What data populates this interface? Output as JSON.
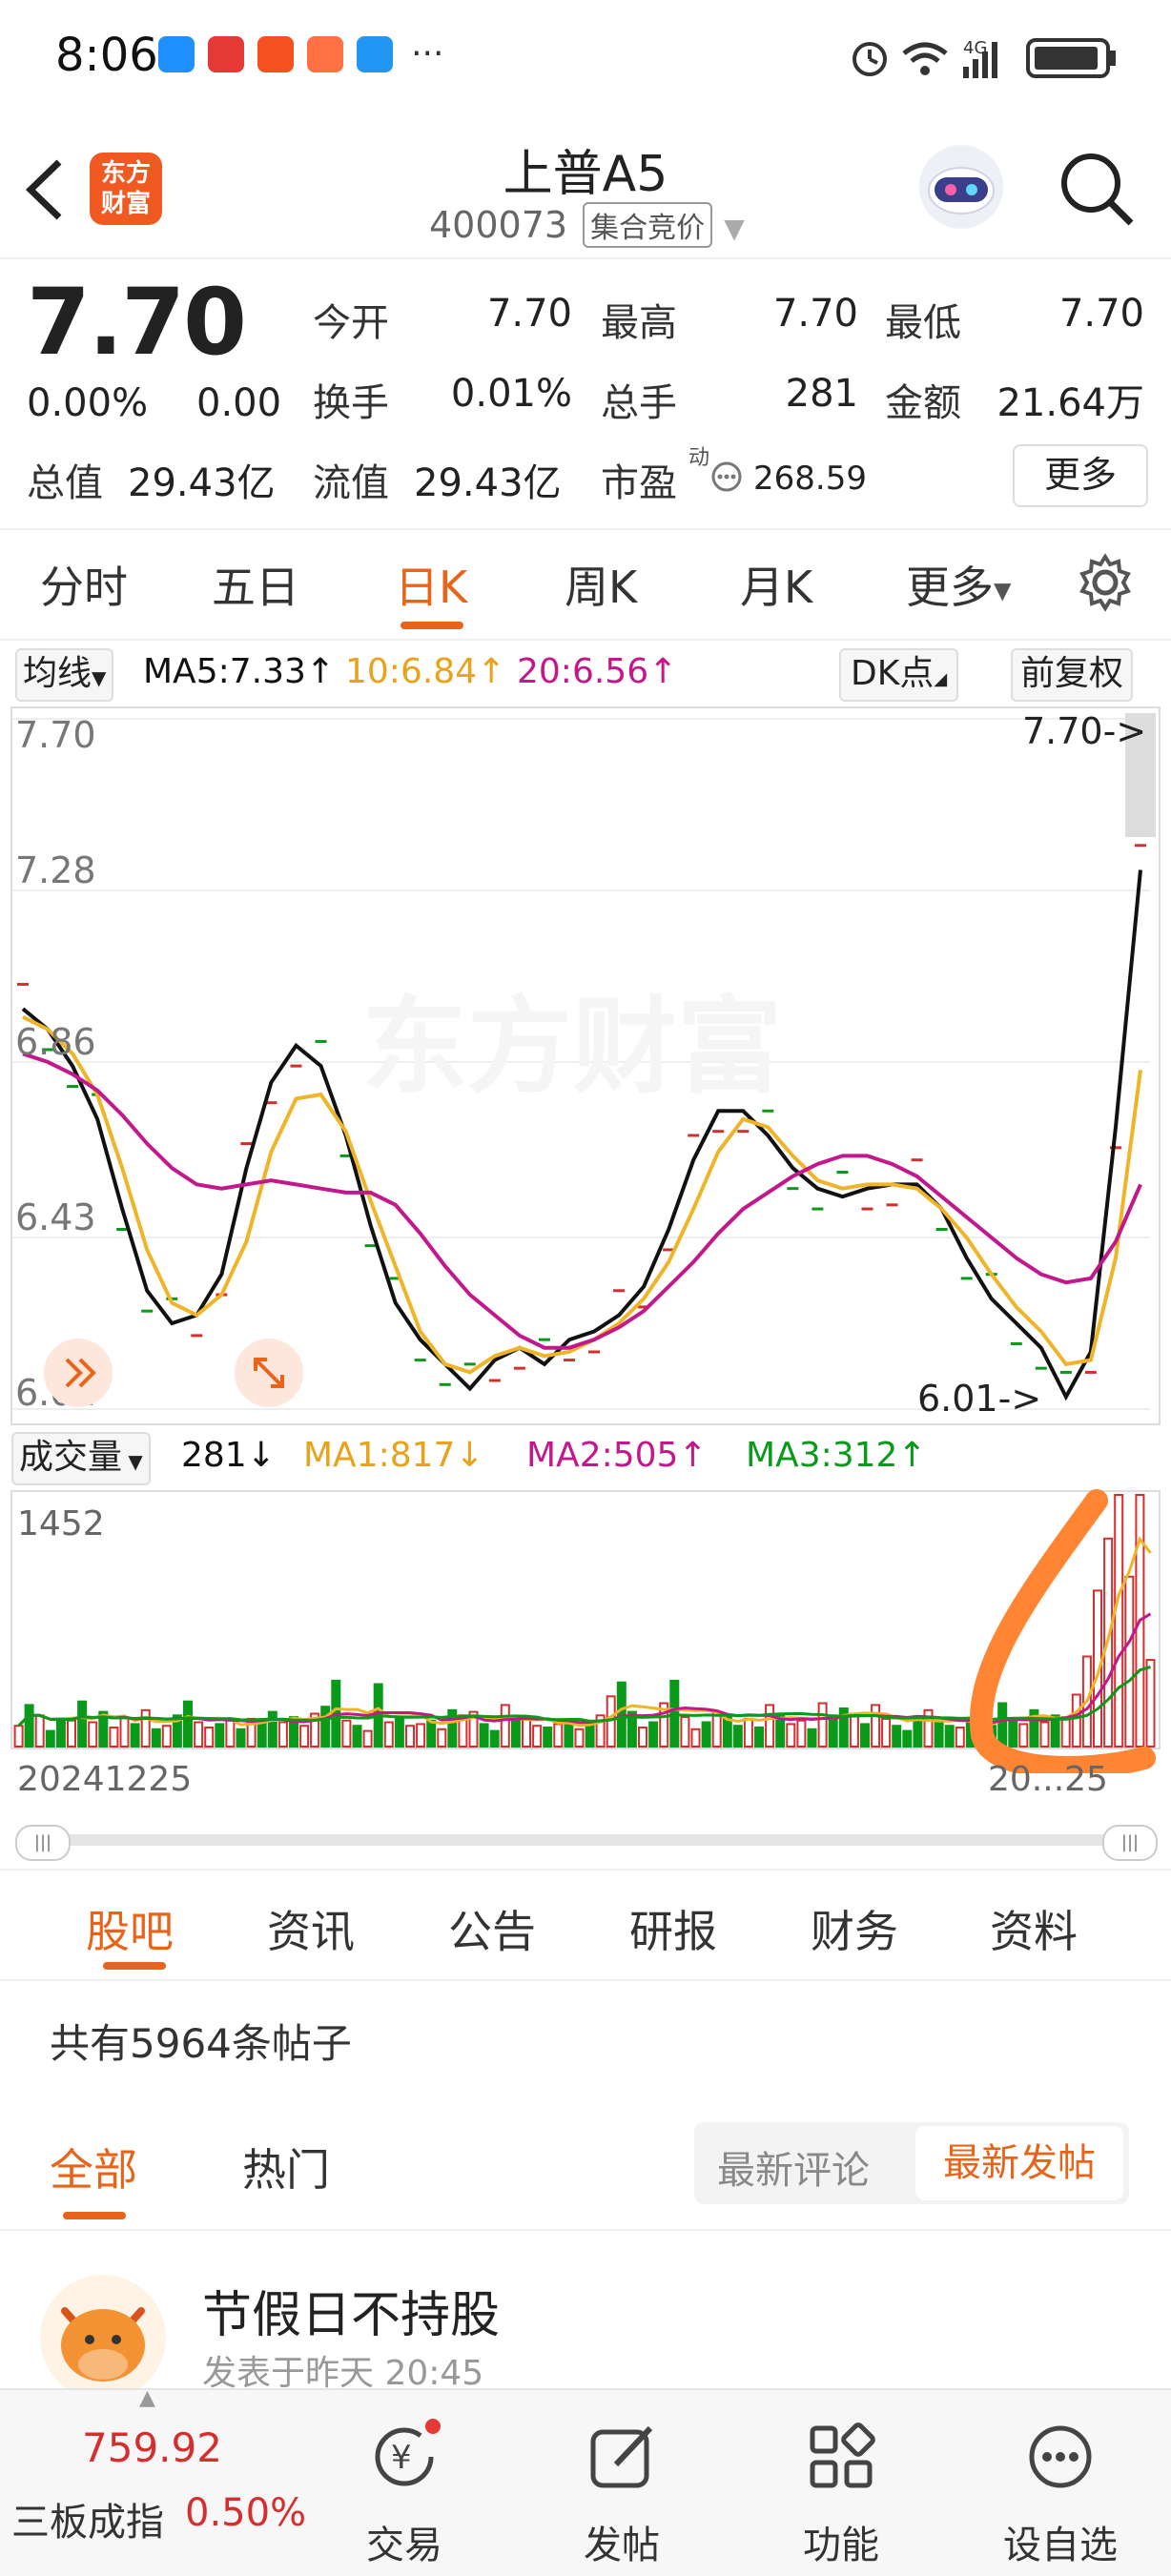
{
  "status_bar": {
    "time": "8:06",
    "more": "···",
    "network": "4G",
    "apps": [
      {
        "name": "哈啰",
        "color": "#1e90ff"
      },
      {
        "name": "日历",
        "color": "#e53935"
      },
      {
        "name": "平安银行",
        "color": "#f4511e"
      },
      {
        "name": "app",
        "color": "#ff7043"
      },
      {
        "name": "天气",
        "color": "#2196f3"
      }
    ]
  },
  "header": {
    "back_icon": "chevron-left-icon",
    "logo_text_1": "东方",
    "logo_text_2": "财富",
    "stock_name": "上普A5",
    "stock_code": "400073",
    "trade_mode": "集合竞价",
    "search_icon": "search-icon"
  },
  "quote": {
    "price": "7.70",
    "change_pct": "0.00%",
    "change": "0.00",
    "open_label": "今开",
    "open": "7.70",
    "high_label": "最高",
    "high": "7.70",
    "low_label": "最低",
    "low": "7.70",
    "turnover_label": "换手",
    "turnover": "0.01%",
    "volume_label": "总手",
    "volume": "281",
    "amount_label": "金额",
    "amount": "21.64万",
    "mkt_cap_label": "总值",
    "mkt_cap": "29.43亿",
    "float_cap_label": "流值",
    "float_cap": "29.43亿",
    "pe_label": "市盈",
    "pe_sup": "动",
    "pe": "268.59",
    "more_button": "更多"
  },
  "chart_tabs": {
    "items": [
      "分时",
      "五日",
      "日K",
      "周K",
      "月K",
      "更多"
    ],
    "active": "日K"
  },
  "kline": {
    "indicator_select": "均线",
    "ma5": "MA5:7.33↑",
    "ma10": "10:6.84↑",
    "ma20": "20:6.56↑",
    "dk_button": "DK点",
    "adjust_button": "前复权",
    "max_marker": "7.70->",
    "min_marker": "6.01->",
    "watermark": "东方财富",
    "colors": {
      "ma5": "#111111",
      "ma10": "#f0b429",
      "ma20": "#c2188b",
      "up": "#d32f2f",
      "down": "#0a9a1a",
      "accent": "#e8641b"
    }
  },
  "volume": {
    "indicator_select": "成交量",
    "vol": "281↓",
    "ma1": "MA1:817↓",
    "ma2": "MA2:505↑",
    "ma3": "MA3:312↑",
    "start_date": "20241225",
    "end_date": "20...25"
  },
  "chart_data": [
    {
      "type": "line",
      "title": "",
      "y_ticks": [
        "7.70",
        "7.28",
        "6.86",
        "6.43",
        "6.01"
      ],
      "ylim": [
        6.01,
        7.7
      ],
      "series": [
        {
          "name": "MA5",
          "values": [
            6.99,
            6.94,
            6.85,
            6.72,
            6.5,
            6.3,
            6.22,
            6.24,
            6.34,
            6.6,
            6.81,
            6.9,
            6.85,
            6.68,
            6.46,
            6.27,
            6.18,
            6.12,
            6.06,
            6.13,
            6.16,
            6.12,
            6.18,
            6.2,
            6.24,
            6.31,
            6.45,
            6.62,
            6.74,
            6.74,
            6.68,
            6.6,
            6.55,
            6.53,
            6.55,
            6.56,
            6.56,
            6.5,
            6.38,
            6.28,
            6.22,
            6.16,
            6.04,
            6.15,
            6.7,
            7.33
          ]
        },
        {
          "name": "10",
          "values": [
            6.97,
            6.94,
            6.88,
            6.78,
            6.6,
            6.4,
            6.27,
            6.24,
            6.29,
            6.42,
            6.64,
            6.77,
            6.78,
            6.69,
            6.52,
            6.36,
            6.2,
            6.12,
            6.1,
            6.14,
            6.16,
            6.14,
            6.15,
            6.18,
            6.22,
            6.28,
            6.37,
            6.5,
            6.64,
            6.72,
            6.7,
            6.63,
            6.57,
            6.55,
            6.56,
            6.56,
            6.55,
            6.5,
            6.43,
            6.34,
            6.26,
            6.2,
            6.12,
            6.13,
            6.38,
            6.84
          ]
        },
        {
          "name": "20",
          "values": [
            6.88,
            6.86,
            6.83,
            6.79,
            6.73,
            6.66,
            6.6,
            6.56,
            6.55,
            6.56,
            6.57,
            6.56,
            6.55,
            6.54,
            6.54,
            6.51,
            6.44,
            6.36,
            6.29,
            6.24,
            6.19,
            6.16,
            6.16,
            6.18,
            6.21,
            6.25,
            6.31,
            6.37,
            6.44,
            6.5,
            6.54,
            6.58,
            6.61,
            6.63,
            6.63,
            6.61,
            6.58,
            6.53,
            6.48,
            6.43,
            6.38,
            6.34,
            6.32,
            6.33,
            6.42,
            6.56
          ]
        }
      ]
    },
    {
      "type": "bar",
      "title": "成交量",
      "y_ticks": [
        "1452"
      ],
      "ylim": [
        0,
        1452
      ],
      "values": [
        120,
        240,
        180,
        90,
        160,
        150,
        260,
        140,
        200,
        110,
        170,
        130,
        210,
        100,
        120,
        180,
        260,
        140,
        110,
        130,
        150,
        100,
        160,
        150,
        200,
        140,
        170,
        120,
        190,
        230,
        380,
        150,
        120,
        90,
        360,
        140,
        170,
        120,
        130,
        150,
        100,
        210,
        180,
        200,
        130,
        90,
        240,
        150,
        170,
        120,
        110,
        130,
        150,
        100,
        140,
        180,
        290,
        370,
        200,
        110,
        140,
        250,
        380,
        170,
        100,
        140,
        200,
        170,
        120,
        160,
        110,
        240,
        190,
        130,
        150,
        100,
        250,
        180,
        220,
        190,
        130,
        240,
        160,
        120,
        90,
        170,
        210,
        150,
        120,
        110,
        140,
        150,
        120,
        250,
        160,
        130,
        210,
        140,
        180,
        170,
        300,
        520,
        900,
        1200,
        1452,
        980,
        1452,
        500
      ],
      "up": [
        1,
        0,
        1,
        0,
        0,
        1,
        0,
        1,
        0,
        1,
        1,
        0,
        1,
        0,
        1,
        0,
        0,
        1,
        1,
        0,
        1,
        0,
        1,
        0,
        0,
        1,
        0,
        1,
        1,
        0,
        0,
        1,
        0,
        1,
        0,
        1,
        0,
        1,
        1,
        0,
        1,
        0,
        1,
        1,
        0,
        0,
        1,
        0,
        1,
        1,
        0,
        1,
        0,
        1,
        0,
        1,
        1,
        0,
        0,
        1,
        0,
        1,
        0,
        1,
        1,
        0,
        1,
        0,
        0,
        1,
        0,
        1,
        0,
        1,
        1,
        0,
        1,
        0,
        0,
        1,
        0,
        1,
        1,
        0,
        0,
        0,
        1,
        0,
        0,
        1,
        0,
        1,
        0,
        0,
        0,
        1,
        0,
        1,
        0,
        1,
        1,
        1,
        1,
        1,
        1,
        1,
        1,
        1
      ]
    }
  ],
  "forum": {
    "tabs": [
      "股吧",
      "资讯",
      "公告",
      "研报",
      "财务",
      "资料"
    ],
    "active": "股吧",
    "post_count": "共有5964条帖子",
    "sub_tabs": [
      "全部",
      "热门"
    ],
    "sort_latest_comment": "最新评论",
    "sort_latest_post": "最新发帖",
    "post_title": "节假日不持股",
    "post_time": "发表于昨天 20:45"
  },
  "bottom_nav": {
    "index_value": "759.92",
    "index_name": "三板成指",
    "index_change": "0.50%",
    "items": [
      {
        "label": "交易",
        "icon": "yuan-trade-icon"
      },
      {
        "label": "发帖",
        "icon": "edit-post-icon"
      },
      {
        "label": "功能",
        "icon": "grid-apps-icon"
      },
      {
        "label": "设自选",
        "icon": "more-circle-icon"
      }
    ]
  }
}
